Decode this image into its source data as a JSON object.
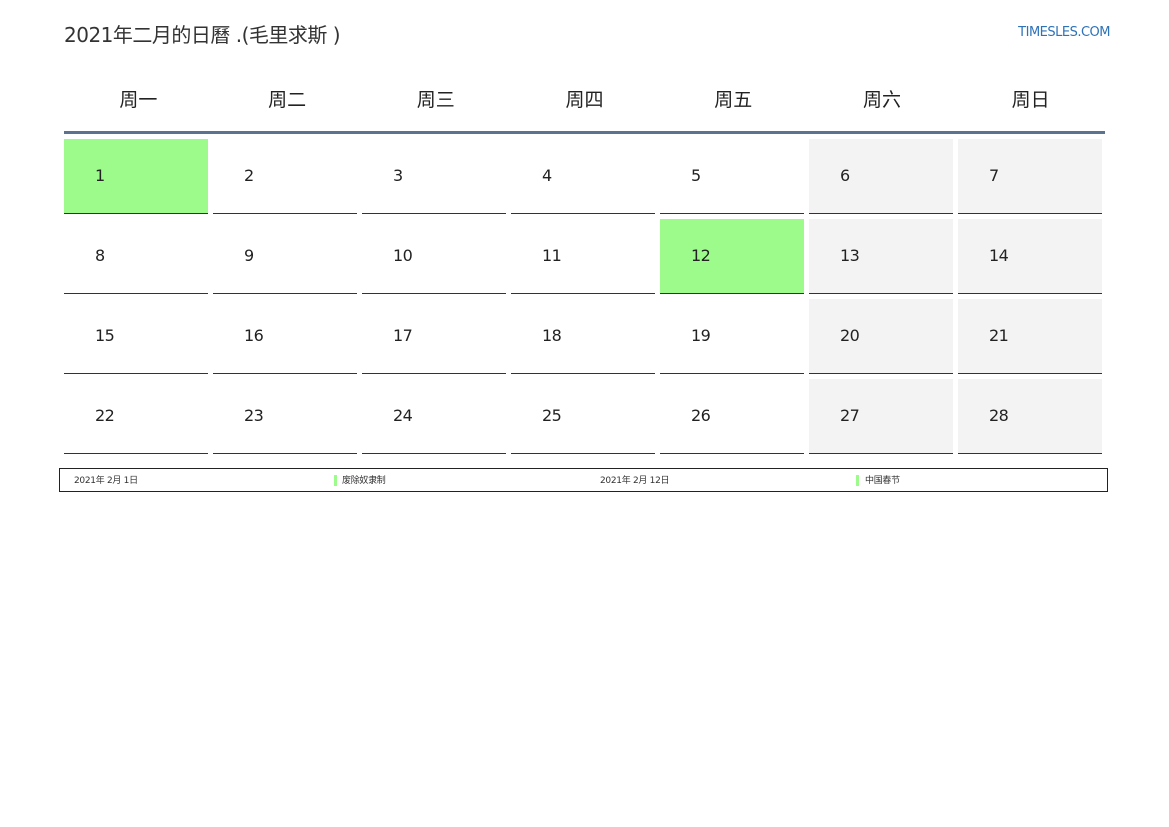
{
  "header": {
    "title": "2021年二月的日曆 .(毛里求斯 )",
    "site": "TIMESLES.COM"
  },
  "weekdays": [
    "周一",
    "周二",
    "周三",
    "周四",
    "周五",
    "周六",
    "周日"
  ],
  "days": [
    {
      "n": "1",
      "holiday": true
    },
    {
      "n": "2"
    },
    {
      "n": "3"
    },
    {
      "n": "4"
    },
    {
      "n": "5"
    },
    {
      "n": "6",
      "weekend": true
    },
    {
      "n": "7",
      "weekend": true
    },
    {
      "n": "8"
    },
    {
      "n": "9"
    },
    {
      "n": "10"
    },
    {
      "n": "11"
    },
    {
      "n": "12",
      "holiday": true
    },
    {
      "n": "13",
      "weekend": true
    },
    {
      "n": "14",
      "weekend": true
    },
    {
      "n": "15"
    },
    {
      "n": "16"
    },
    {
      "n": "17"
    },
    {
      "n": "18"
    },
    {
      "n": "19"
    },
    {
      "n": "20",
      "weekend": true
    },
    {
      "n": "21",
      "weekend": true
    },
    {
      "n": "22"
    },
    {
      "n": "23"
    },
    {
      "n": "24"
    },
    {
      "n": "25"
    },
    {
      "n": "26"
    },
    {
      "n": "27",
      "weekend": true
    },
    {
      "n": "28",
      "weekend": true
    }
  ],
  "holidays": [
    {
      "date": "2021年 2月 1日",
      "name": "废除奴隶制"
    },
    {
      "date": "2021年 2月 12日",
      "name": "中国春节"
    }
  ],
  "colors": {
    "holiday": "#9dfb8b",
    "weekend": "#f3f3f3",
    "rule": "#5b7291",
    "link": "#2e72b8"
  }
}
